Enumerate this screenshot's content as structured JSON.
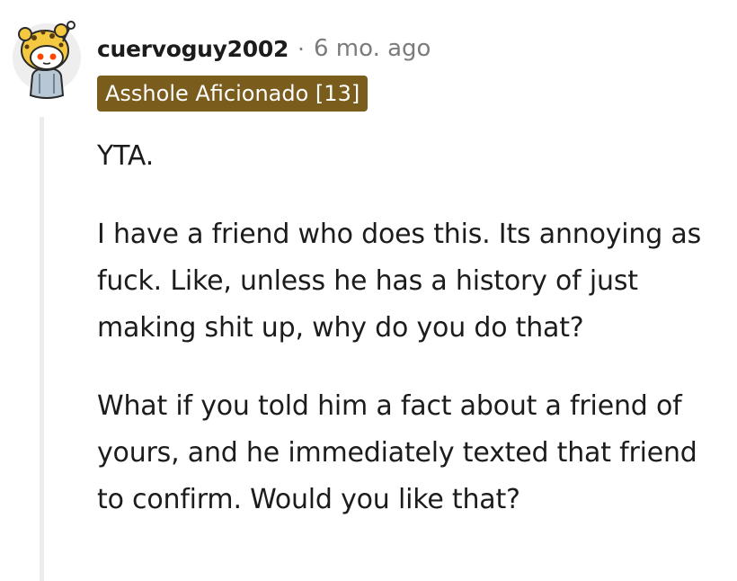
{
  "comment": {
    "username": "cuervoguy2002",
    "separator": "·",
    "timestamp": "6 mo. ago",
    "flair": "Asshole Aficionado [13]",
    "paragraphs": [
      "YTA.",
      "I have a friend who does this. Its annoying as fuck. Like, unless he has a history of just making shit up, why do you do that?",
      "What if you told him a fact about a friend of yours, and he immediately texted that friend to confirm. Would you like that?"
    ]
  },
  "colors": {
    "flair_background": "#7a5c1c",
    "meta_text": "#7c7c7c",
    "thread_line": "#ececec"
  },
  "icons": {
    "avatar": "snoo-avatar-leopard-hood"
  }
}
